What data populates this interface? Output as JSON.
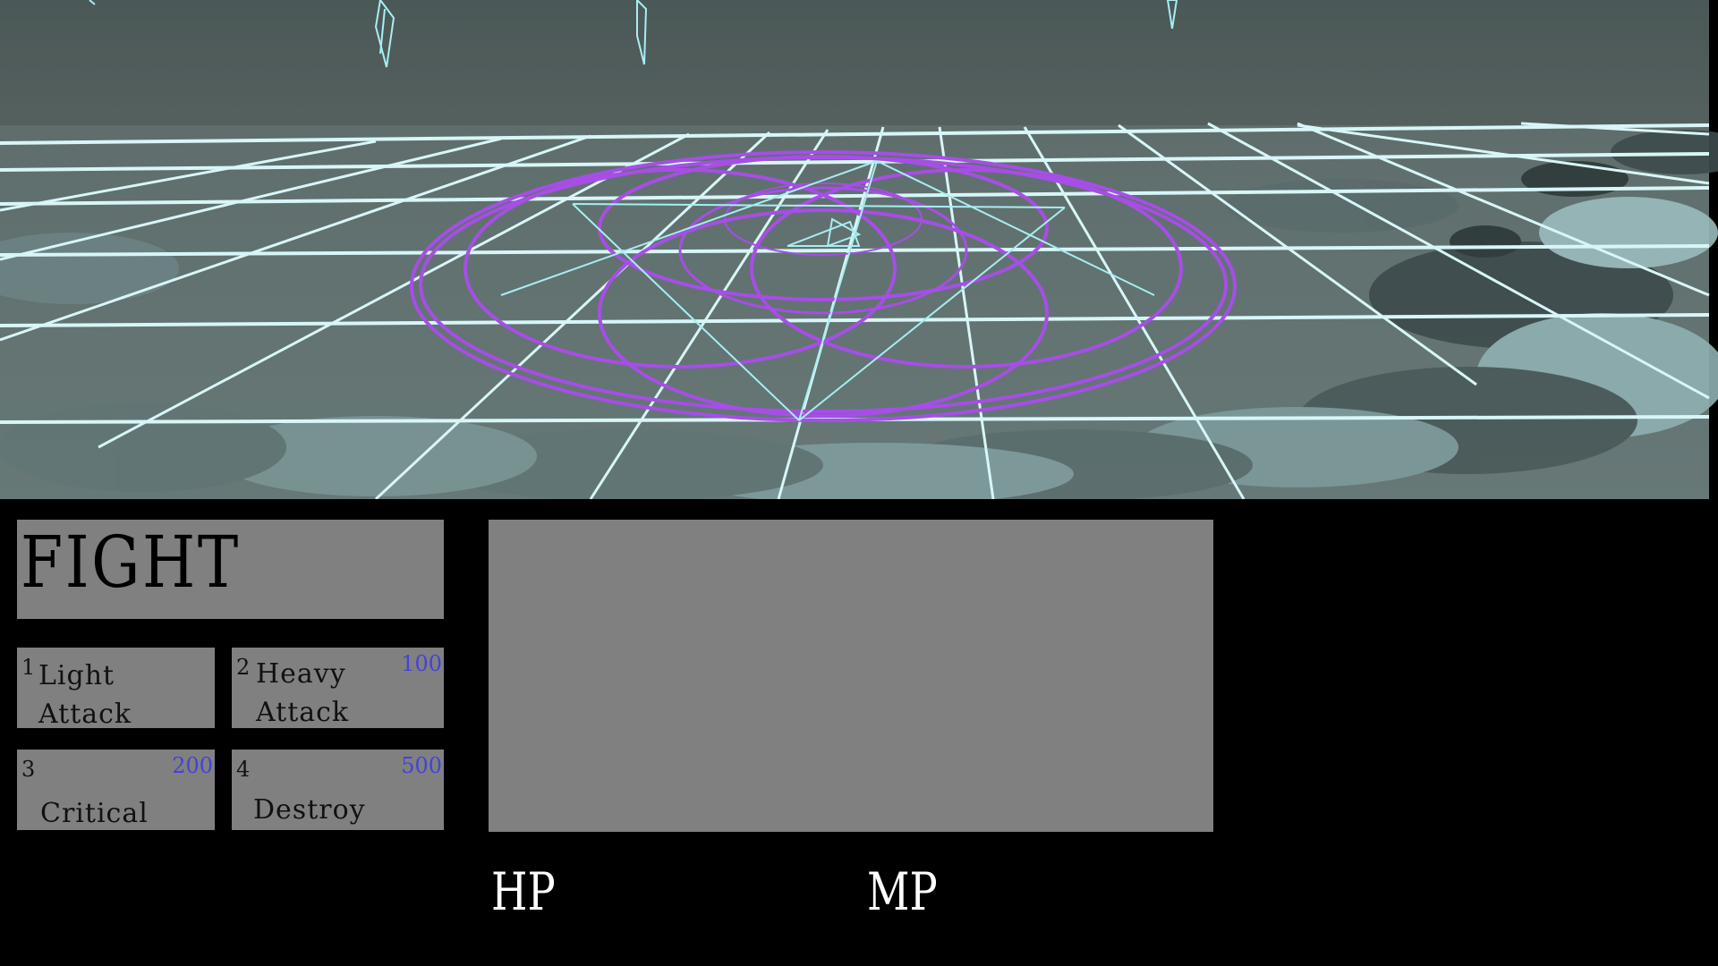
{
  "scene": {
    "description_colors": {
      "sky": "#4e5c5b",
      "floor": "#6f8a8a",
      "grid": "#d8f6f8",
      "magic_circle": "#a64ee6"
    }
  },
  "menu": {
    "title": "FIGHT",
    "skills": [
      {
        "key": "1",
        "name": "Light\nAttack",
        "cost": ""
      },
      {
        "key": "2",
        "name": "Heavy\nAttack",
        "cost": "100"
      },
      {
        "key": "3",
        "name": "Critical",
        "cost": "200"
      },
      {
        "key": "4",
        "name": "Destroy",
        "cost": "500"
      }
    ]
  },
  "message": {
    "text": ""
  },
  "stats": {
    "hp_label": "HP",
    "mp_label": "MP"
  }
}
